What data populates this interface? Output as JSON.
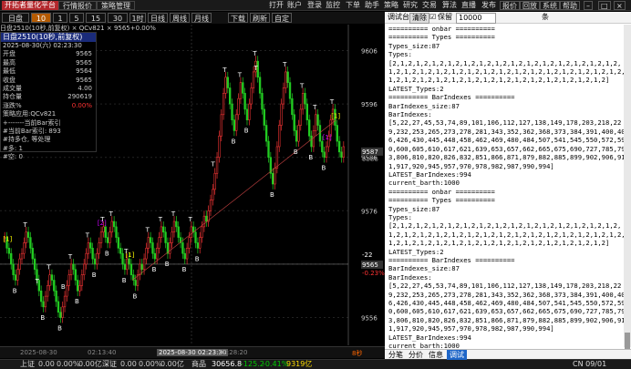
{
  "app": {
    "logo": "开拓者量化平台",
    "tabs": [
      "行情报价",
      "策略管理"
    ],
    "menu": [
      "打开",
      "账户",
      "登录",
      "监控",
      "下单",
      "助手",
      "策略",
      "研究",
      "交易",
      "算法",
      "直播",
      "发布"
    ],
    "buttons": [
      "报价",
      "回放",
      "系统",
      "帮助"
    ]
  },
  "toolbar": {
    "symbol": "日盘2510",
    "periods": [
      "10秒",
      "1分",
      "5分",
      "15分",
      "30分",
      "1时",
      "日线",
      "周线",
      "月线",
      "下载",
      "刷新",
      "自定"
    ],
    "active_period": "10秒"
  },
  "chart_info": "日盘2510(10秒,前复权) × QCv821 × 9565+0.00%",
  "info_panel": {
    "header": "日盘2510(10秒,前复权)",
    "datetime": "2025-08-30(六) 02:23:30",
    "rows": [
      [
        "开盘",
        "9565"
      ],
      [
        "最高",
        "9565"
      ],
      [
        "最低",
        "9564"
      ],
      [
        "收盘",
        "9565"
      ],
      [
        "成交量",
        "4.00"
      ],
      [
        "持仓量",
        "290619"
      ],
      [
        "涨跌%",
        "0.00%"
      ]
    ],
    "notes": [
      "策略应用:QCv821",
      "+-------当前Bar索引",
      "#当前Bar索引: 893",
      "#持多仓, 等处理",
      "#多: 1",
      "#空: 0"
    ]
  },
  "price_axis": {
    "labels": [
      "9606",
      "9596",
      "9586",
      "9576",
      "9566",
      "9556"
    ],
    "current": "9587",
    "current2": "9586",
    "tag1": "-22",
    "tag2": "9565",
    "tag3": "-0.23%"
  },
  "time_axis": {
    "labels": [
      "2025-08-30",
      "02:13:40",
      "2025-08-30 02:23:30",
      "02:28:20"
    ],
    "period_tag": "8秒"
  },
  "status_bar": {
    "items": [
      "上证",
      "0.00",
      "0.00%",
      "0.00亿",
      "深证",
      "0.00",
      "0.00%",
      "0.00亿",
      "商品",
      "30656.8",
      "-125.2",
      "-0.41%",
      "9319亿"
    ],
    "time": "CN 09/01 09:11:22"
  },
  "right_panel": {
    "title": "调试台",
    "clear": "清除",
    "keep": "保留",
    "count": "10000",
    "tab_label": "条",
    "tabs": [
      "分笔",
      "分价",
      "信息",
      "调试"
    ],
    "log": "========== onbar ==========\n========== Types ==========\nTypes_size:87\nTypes:\n[2,1,2,1,2,1,2,1,2,1,2,1,2,1,2,1,2,1,2,1,2,1,2,1,2,1,2,1,2,1,2,1,2,1,2,1,2,1,2,1,2,1,2,1,2,1,2,1,2,1,2,1,2,1,2,1,2,1,2,1,2,1,2,1,2,1,2,1,2,1,2,1,2,1,2,1,2,1,2,1,2,1,2,1,2,1,2]\nLATEST_Types:2\n========== BarIndexes ==========\nBarIndexes_size:87\nBarIndexes:\n[5,22,27,45,53,74,89,101,106,112,127,138,149,178,203,218,229,232,253,265,273,278,281,343,352,362,368,373,384,391,400,406,426,430,445,448,458,462,469,480,484,507,541,545,550,572,590,600,605,610,617,621,639,653,657,662,665,675,690,727,785,793,806,810,820,826,832,851,866,871,879,882,885,899,902,906,911,917,920,945,957,970,978,982,987,990,994]\nLATEST_BarIndexes:994\ncurrent_barth:1000\n========== onbar ==========\n========== Types ==========\nTypes_size:87\nTypes:\n[2,1,2,1,2,1,2,1,2,1,2,1,2,1,2,1,2,1,2,1,2,1,2,1,2,1,2,1,2,1,2,1,2,1,2,1,2,1,2,1,2,1,2,1,2,1,2,1,2,1,2,1,2,1,2,1,2,1,2,1,2,1,2,1,2,1,2,1,2,1,2,1,2,1,2,1,2,1,2,1,2,1,2,1,2,1,2]\nLATEST_Types:2\n========== BarIndexes ==========\nBarIndexes_size:87\nBarIndexes:\n[5,22,27,45,53,74,89,101,106,112,127,138,149,178,203,218,229,232,253,265,273,278,281,343,352,362,368,373,384,391,400,406,426,430,445,448,458,462,469,480,484,507,541,545,550,572,590,600,605,610,617,621,639,653,657,662,665,675,690,727,785,793,806,810,820,826,832,851,866,871,879,882,885,899,902,906,911,917,920,945,957,970,978,982,987,990,994]\nLATEST_BarIndexes:994\ncurrent_barth:1000"
  },
  "chart_data": {
    "type": "candlestick",
    "price_range": [
      9552,
      9610
    ],
    "closes": [
      9571,
      9569,
      9568,
      9566,
      9564,
      9563,
      9565,
      9567,
      9568,
      9570,
      9572,
      9571,
      9569,
      9567,
      9565,
      9563,
      9561,
      9559,
      9558,
      9560,
      9562,
      9564,
      9563,
      9561,
      9559,
      9557,
      9556,
      9558,
      9560,
      9562,
      9564,
      9566,
      9565,
      9563,
      9561,
      9562,
      9564,
      9566,
      9568,
      9570,
      9569,
      9567,
      9566,
      9568,
      9570,
      9572,
      9573,
      9571,
      9570,
      9572,
      9574,
      9573,
      9571,
      9569,
      9568,
      9566,
      9565,
      9567,
      9566,
      9564,
      9563,
      9562,
      9564,
      9566,
      9565,
      9567,
      9569,
      9571,
      9570,
      9568,
      9567,
      9569,
      9571,
      9573,
      9572,
      9570,
      9568,
      9570,
      9572,
      9574,
      9573,
      9571,
      9570,
      9568,
      9567,
      9569,
      9571,
      9573,
      9572,
      9570,
      9569,
      9571,
      9573,
      9575,
      9574,
      9576,
      9578,
      9580,
      9583,
      9586,
      9590,
      9594,
      9598,
      9601,
      9599,
      9596,
      9593,
      9591,
      9594,
      9597,
      9600,
      9598,
      9595,
      9593,
      9596,
      9599,
      9602,
      9604,
      9601,
      9598,
      9595,
      9592,
      9589,
      9586,
      9583,
      9581,
      9584,
      9588,
      9592,
      9596,
      9599,
      9602,
      9600,
      9597,
      9594,
      9591,
      9589,
      9592,
      9595,
      9598,
      9596,
      9593,
      9590,
      9588,
      9591,
      9594,
      9592,
      9589,
      9587,
      9586,
      9588,
      9590,
      9593,
      9595,
      9592,
      9589,
      9587,
      9586,
      9588
    ],
    "markers": [
      {
        "i": 1,
        "text": "[1]",
        "c": "#ff0"
      },
      {
        "i": 16,
        "text": "T",
        "c": "#fff"
      },
      {
        "i": 28,
        "text": "B",
        "c": "#fff"
      },
      {
        "i": 45,
        "text": "[2]",
        "c": "#c0f"
      },
      {
        "i": 58,
        "text": "[1]",
        "c": "#ff0"
      },
      {
        "i": 98,
        "text": "T",
        "c": "#fff"
      },
      {
        "i": 118,
        "text": "T",
        "c": "#fff"
      },
      {
        "i": 150,
        "text": "[1]",
        "c": "#c0f"
      },
      {
        "i": 154,
        "text": "[1]",
        "c": "#ff0"
      }
    ]
  }
}
